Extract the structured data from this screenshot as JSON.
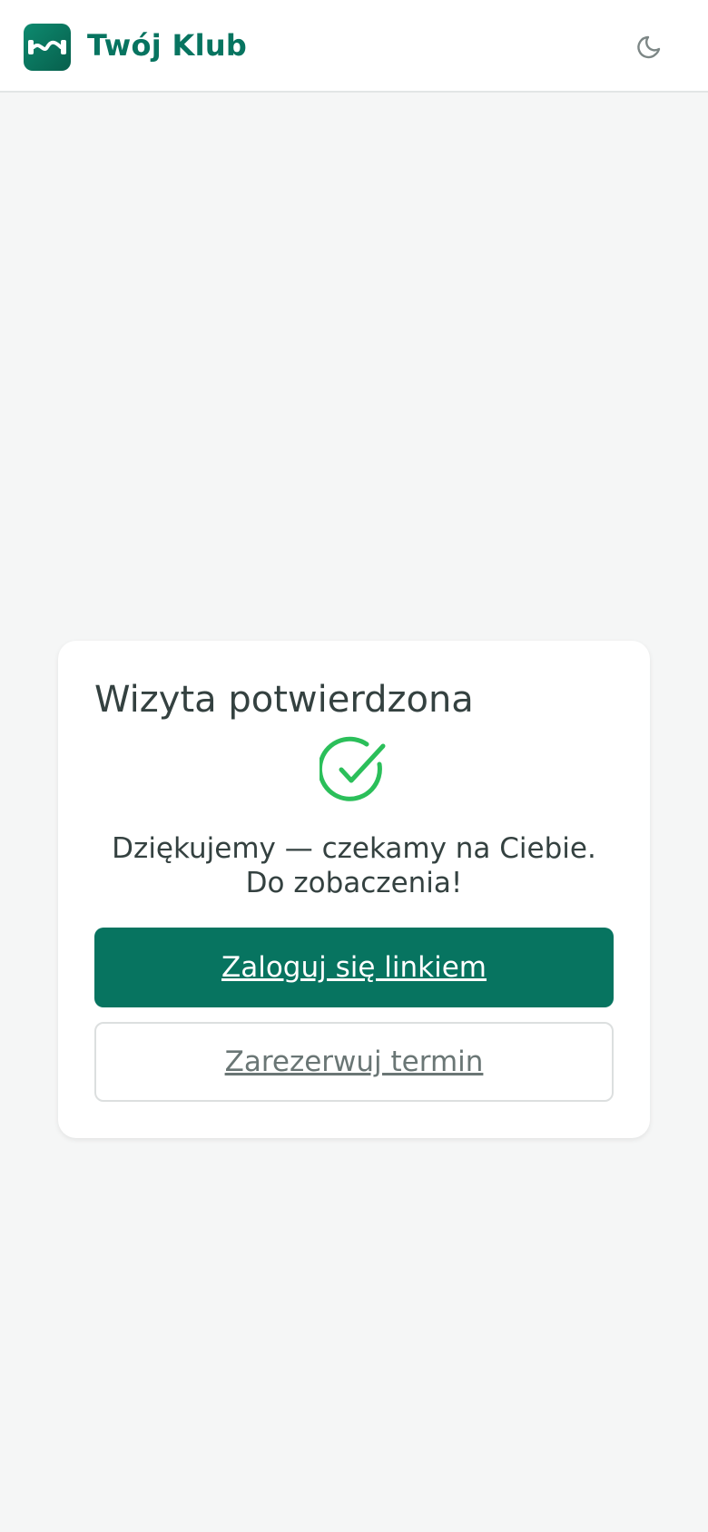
{
  "header": {
    "brand": "Twój Klub",
    "logo_icon": "dumbbell-icon",
    "theme_icon": "moon-icon"
  },
  "card": {
    "title": "Wizyta potwierdzona",
    "status_icon": "check-circle-icon",
    "message_line1": "Dziękujemy — czekamy na Ciebie.",
    "message_line2": "Do zobaczenia!",
    "primary_button": "Zaloguj się linkiem",
    "secondary_button": "Zarezerwuj termin"
  },
  "colors": {
    "brand": "#077460",
    "success": "#2bbf5a",
    "background": "#f5f6f6"
  }
}
